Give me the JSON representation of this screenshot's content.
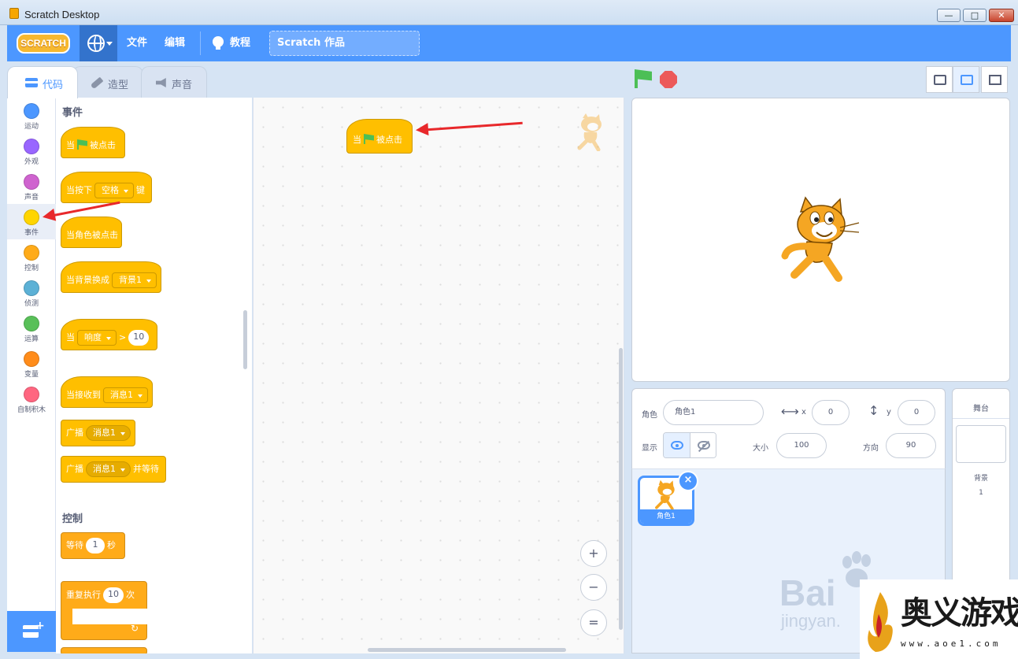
{
  "window": {
    "title": "Scratch Desktop",
    "min": "—",
    "max": "□",
    "close": "✕"
  },
  "menubar": {
    "logo_text": "SCRATCH",
    "file": "文件",
    "edit": "编辑",
    "tutorials": "教程",
    "project_title": "Scratch 作品"
  },
  "tabs": [
    {
      "label": "代码",
      "icon": "code-icon",
      "active": true
    },
    {
      "label": "造型",
      "icon": "brush-icon"
    },
    {
      "label": "声音",
      "icon": "sound-icon"
    }
  ],
  "categories": [
    {
      "label": "运动",
      "color": "#4c97ff"
    },
    {
      "label": "外观",
      "color": "#9966ff"
    },
    {
      "label": "声音",
      "color": "#cf63cf"
    },
    {
      "label": "事件",
      "color": "#ffd500",
      "selected": true
    },
    {
      "label": "控制",
      "color": "#ffab19"
    },
    {
      "label": "侦测",
      "color": "#5cb1d6"
    },
    {
      "label": "运算",
      "color": "#59c059"
    },
    {
      "label": "变量",
      "color": "#ff8c1a"
    },
    {
      "label": "自制积木",
      "color": "#ff6680"
    }
  ],
  "palette": {
    "events_heading": "事件",
    "control_heading": "控制",
    "when_flag": {
      "pre": "当",
      "post": "被点击"
    },
    "when_key": {
      "pre": "当按下",
      "key": "空格",
      "post": "键"
    },
    "when_sprite_clicked": "当角色被点击",
    "when_backdrop": {
      "pre": "当背景换成",
      "value": "背景1"
    },
    "when_loudness": {
      "pre": "当",
      "sensor": "响度",
      "op": ">",
      "value": "10"
    },
    "when_receive": {
      "pre": "当接收到",
      "value": "消息1"
    },
    "broadcast": {
      "pre": "广播",
      "value": "消息1"
    },
    "broadcast_wait": {
      "pre": "广播",
      "value": "消息1",
      "post": "并等待"
    },
    "wait": {
      "pre": "等待",
      "value": "1",
      "post": "秒"
    },
    "repeat": {
      "pre": "重复执行",
      "value": "10",
      "post": "次",
      "loop_icon": "↻"
    }
  },
  "script": {
    "block": {
      "pre": "当",
      "post": "被点击"
    }
  },
  "zoom": {
    "in": "+",
    "out": "−",
    "reset": "="
  },
  "sprite_info": {
    "sprite_label": "角色",
    "sprite_name": "角色1",
    "x_label": "x",
    "x_value": "0",
    "y_label": "y",
    "y_value": "0",
    "show_label": "显示",
    "size_label": "大小",
    "size_value": "100",
    "direction_label": "方向",
    "direction_value": "90",
    "x_arrow": "⟷",
    "y_arrow": "↕"
  },
  "sprites": [
    {
      "name": "角色1"
    }
  ],
  "stage_panel": {
    "title": "舞台",
    "backdrops_label": "背景",
    "backdrops_count": "1"
  },
  "watermarks": {
    "baidu_big": "Bai",
    "baidu_small": "jingyan.",
    "site_cn": "奥义游戏网",
    "site_url": "www.aoe1.com"
  },
  "colors": {
    "brand": "#4c97ff",
    "events": "#ffbf00",
    "control": "#ffab19",
    "annotation_arrow": "#e8282b"
  }
}
